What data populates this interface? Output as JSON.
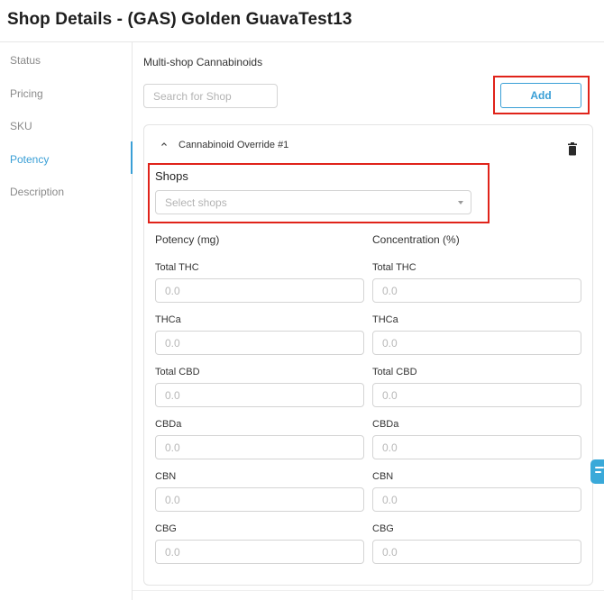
{
  "page": {
    "title": "Shop Details - (GAS) Golden GuavaTest13"
  },
  "sidebar": {
    "items": [
      {
        "label": "Status",
        "active": false
      },
      {
        "label": "Pricing",
        "active": false
      },
      {
        "label": "SKU",
        "active": false
      },
      {
        "label": "Potency",
        "active": true
      },
      {
        "label": "Description",
        "active": false
      }
    ]
  },
  "main": {
    "section_title": "Multi-shop Cannabinoids",
    "search": {
      "placeholder": "Search for Shop",
      "value": ""
    },
    "add_label": "Add",
    "override": {
      "title": "Cannabinoid Override #1",
      "shops_label": "Shops",
      "shops_placeholder": "Select shops",
      "potency_header": "Potency (mg)",
      "concentration_header": "Concentration (%)",
      "fields": [
        {
          "label": "Total THC",
          "potency_placeholder": "0.0",
          "concentration_placeholder": "0.0"
        },
        {
          "label": "THCa",
          "potency_placeholder": "0.0",
          "concentration_placeholder": "0.0"
        },
        {
          "label": "Total CBD",
          "potency_placeholder": "0.0",
          "concentration_placeholder": "0.0"
        },
        {
          "label": "CBDa",
          "potency_placeholder": "0.0",
          "concentration_placeholder": "0.0"
        },
        {
          "label": "CBN",
          "potency_placeholder": "0.0",
          "concentration_placeholder": "0.0"
        },
        {
          "label": "CBG",
          "potency_placeholder": "0.0",
          "concentration_placeholder": "0.0"
        }
      ]
    }
  },
  "icons": {
    "collapse": "chevron-up-icon",
    "delete": "trash-icon",
    "dropdown": "caret-down-icon",
    "chat": "chat-icon"
  },
  "colors": {
    "accent": "#3a9fd6",
    "highlight": "#e0231a",
    "chat_widget": "#3aa9d9"
  }
}
